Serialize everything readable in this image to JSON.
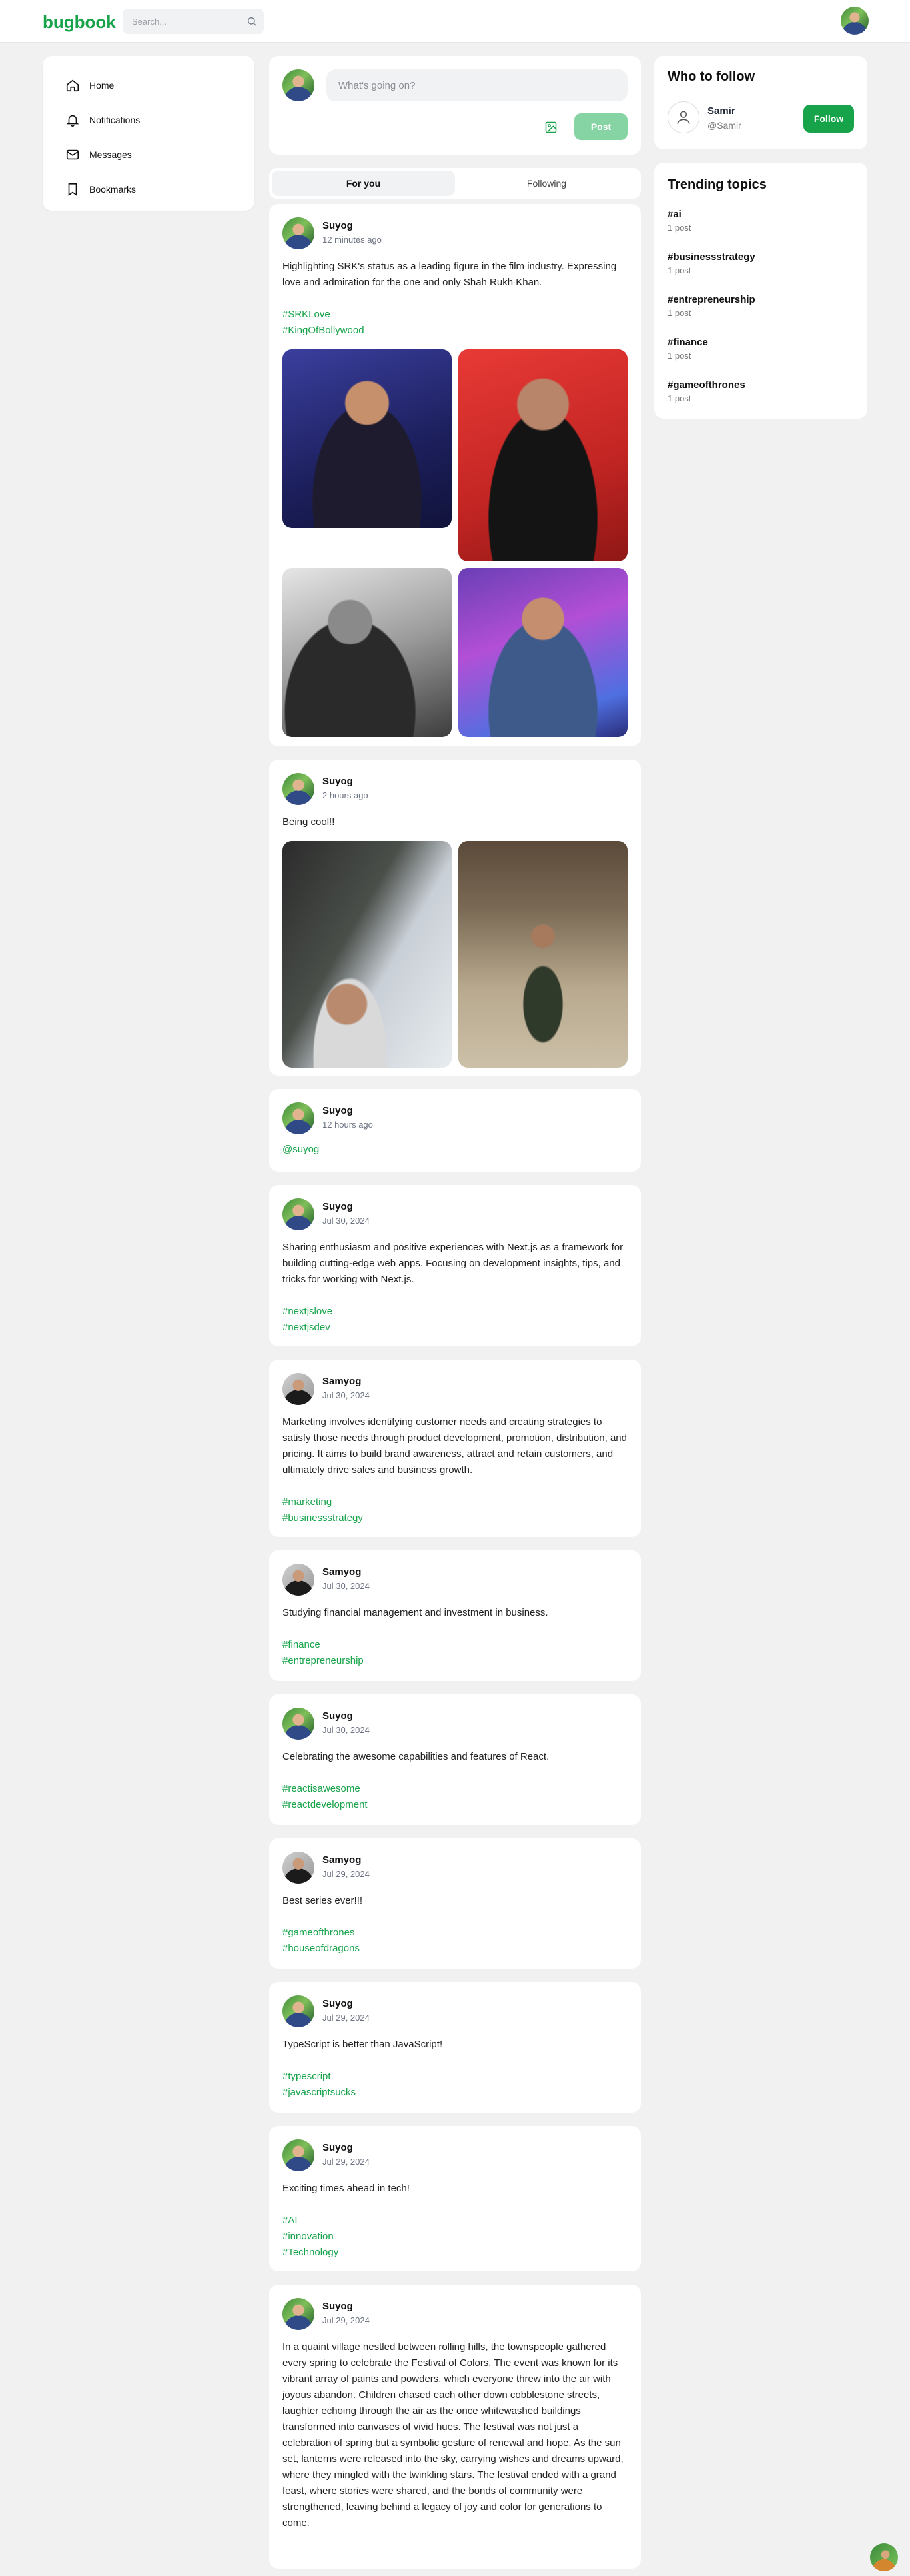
{
  "app": {
    "logo": "bugbook"
  },
  "search": {
    "placeholder": "Search..."
  },
  "nav": {
    "items": [
      {
        "label": "Home",
        "icon": "home-icon"
      },
      {
        "label": "Notifications",
        "icon": "bell-icon"
      },
      {
        "label": "Messages",
        "icon": "mail-icon"
      },
      {
        "label": "Bookmarks",
        "icon": "bookmark-icon"
      }
    ]
  },
  "composer": {
    "placeholder": "What's going on?",
    "post_label": "Post"
  },
  "tabs": [
    {
      "label": "For you",
      "active": true
    },
    {
      "label": "Following",
      "active": false
    }
  ],
  "who_to_follow": {
    "title": "Who to follow",
    "users": [
      {
        "name": "Samir",
        "handle": "@Samir",
        "button": "Follow"
      }
    ]
  },
  "trending": {
    "title": "Trending topics",
    "topics": [
      {
        "tag": "#ai",
        "count": "1 post"
      },
      {
        "tag": "#businessstrategy",
        "count": "1 post"
      },
      {
        "tag": "#entrepreneurship",
        "count": "1 post"
      },
      {
        "tag": "#finance",
        "count": "1 post"
      },
      {
        "tag": "#gameofthrones",
        "count": "1 post"
      }
    ]
  },
  "posts": [
    {
      "author": "Suyog",
      "time": "12 minutes ago",
      "text": "Highlighting SRK's status as a leading figure in the film industry. Expressing love and admiration for the one and only Shah Rukh Khan.",
      "hashtags": [
        "#SRKLove",
        "#KingOfBollywood"
      ]
    },
    {
      "author": "Suyog",
      "time": "2 hours ago",
      "text": "Being cool!!"
    },
    {
      "author": "Suyog",
      "time": "12 hours ago",
      "mention": "@suyog"
    },
    {
      "author": "Suyog",
      "time": "Jul 30, 2024",
      "text": "Sharing enthusiasm and positive experiences with Next.js as a framework for building cutting-edge web apps. Focusing on development insights, tips, and tricks for working with Next.js.",
      "hashtags": [
        "#nextjslove",
        "#nextjsdev"
      ]
    },
    {
      "author": "Samyog",
      "time": "Jul 30, 2024",
      "text": "Marketing involves identifying customer needs and creating strategies to satisfy those needs through product development, promotion, distribution, and pricing. It aims to build brand awareness, attract and retain customers, and ultimately drive sales and business growth.",
      "hashtags": [
        "#marketing",
        "#businessstrategy"
      ]
    },
    {
      "author": "Samyog",
      "time": "Jul 30, 2024",
      "text": "Studying financial management and investment in business.",
      "hashtags": [
        "#finance",
        "#entrepreneurship"
      ]
    },
    {
      "author": "Suyog",
      "time": "Jul 30, 2024",
      "text": "Celebrating the awesome capabilities and features of React.",
      "hashtags": [
        "#reactisawesome",
        "#reactdevelopment"
      ]
    },
    {
      "author": "Samyog",
      "time": "Jul 29, 2024",
      "text": "Best series ever!!!",
      "hashtags": [
        "#gameofthrones",
        "#houseofdragons"
      ]
    },
    {
      "author": "Suyog",
      "time": "Jul 29, 2024",
      "text": "TypeScript is better than JavaScript!",
      "hashtags": [
        "#typescript",
        "#javascriptsucks"
      ]
    },
    {
      "author": "Suyog",
      "time": "Jul 29, 2024",
      "text": "Exciting times ahead in tech!",
      "hashtags": [
        "#AI",
        "#innovation",
        "#Technology"
      ]
    },
    {
      "author": "Suyog",
      "time": "Jul 29, 2024",
      "text": "In a quaint village nestled between rolling hills, the townspeople gathered every spring to celebrate the Festival of Colors. The event was known for its vibrant array of paints and powders, which everyone threw into the air with joyous abandon. Children chased each other down cobblestone streets, laughter echoing through the air as the once whitewashed buildings transformed into canvases of vivid hues. The festival was not just a celebration of spring but a symbolic gesture of renewal and hope. As the sun set, lanterns were released into the sky, carrying wishes and dreams upward, where they mingled with the twinkling stars. The festival ended with a grand feast, where stories were shared, and the bonds of community were strengthened, leaving behind a legacy of joy and color for generations to come."
    }
  ],
  "colors": {
    "brand": "#16a34a",
    "post_button": "#86d4a3",
    "background": "#f1f1f2"
  }
}
